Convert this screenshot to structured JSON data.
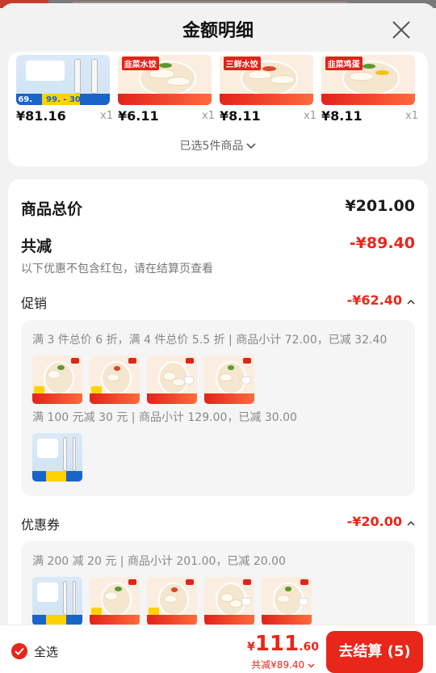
{
  "header": {
    "title": "金额明细"
  },
  "products": [
    {
      "price": "¥81.16",
      "qty": "x1",
      "thumb": "device",
      "thumb_texts": [
        "69.",
        "99.",
        "30"
      ]
    },
    {
      "price": "¥6.11",
      "qty": "x1",
      "thumb": "dumpling",
      "label": "韭菜水饺"
    },
    {
      "price": "¥8.11",
      "qty": "x1",
      "thumb": "dumpling",
      "label": "三鲜水饺"
    },
    {
      "price": "¥8.11",
      "qty": "x1",
      "thumb": "dumpling",
      "label": "韭菜鸡蛋"
    }
  ],
  "selected_count": "已选5件商品",
  "summary": {
    "total_label": "商品总价",
    "total_value": "¥201.00",
    "reduce_label": "共减",
    "reduce_value": "-¥89.40",
    "reduce_note": "以下优惠不包含红包，请在结算页查看"
  },
  "promotion": {
    "label": "促销",
    "value": "-¥62.40",
    "rule1": "满 3 件总价 6 折，满 4 件总价 5.5 折 | 商品小计 72.00，已减 32.40",
    "rule2": "满 100 元减 30 元 | 商品小计 129.00，已减 30.00"
  },
  "coupon": {
    "label": "优惠券",
    "value": "-¥20.00",
    "rule1": "满 200 减 20 元 | 商品小计 201.00，已减 20.00"
  },
  "footer": {
    "select_all": "全选",
    "currency": "¥",
    "pay_int": "111",
    "pay_dec": ".60",
    "reduce_text": "共减¥89.40",
    "checkout": "去结算 (5)"
  },
  "colors": {
    "accent": "#e8261a",
    "background": "#f2f2f2"
  },
  "icons": [
    "close-icon",
    "chevron-down-icon",
    "chevron-up-icon",
    "check-icon"
  ]
}
